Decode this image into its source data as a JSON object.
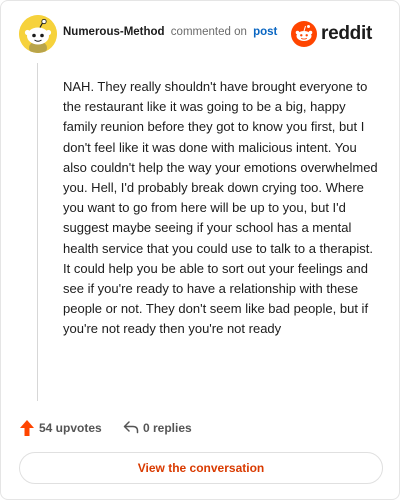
{
  "header": {
    "username": "Numerous-Method",
    "action_text": "commented on",
    "post_link": "post",
    "brand_name": "reddit",
    "avatar_icon": "snoo-avatar-icon",
    "brand_icon": "reddit-logo-icon"
  },
  "comment": {
    "body": "NAH. They really shouldn't have brought everyone to the restaurant like it was going to be a big, happy family reunion before they got to know you first, but I don't feel like it was done with malicious intent. You also couldn't help the way your emotions overwhelmed you. Hell, I'd probably break down crying too. Where you want to go from here will be up to you, but I'd suggest maybe seeing if your school has a mental health service that you could use to talk to a therapist. It could help you be able to sort out your feelings and see if you're ready to have a relationship with these people or not. They don't seem like bad people, but if you're not ready then you're not ready"
  },
  "actions": {
    "upvotes_label": "54 upvotes",
    "replies_label": "0 replies",
    "upvote_icon": "upvote-arrow-icon",
    "reply_icon": "reply-arrow-icon"
  },
  "footer": {
    "view_conversation_label": "View the conversation"
  },
  "colors": {
    "reddit_orange": "#ff4500",
    "link_blue": "#0a66c2",
    "button_text": "#d93a00",
    "avatar_yellow": "#f6d23c"
  }
}
